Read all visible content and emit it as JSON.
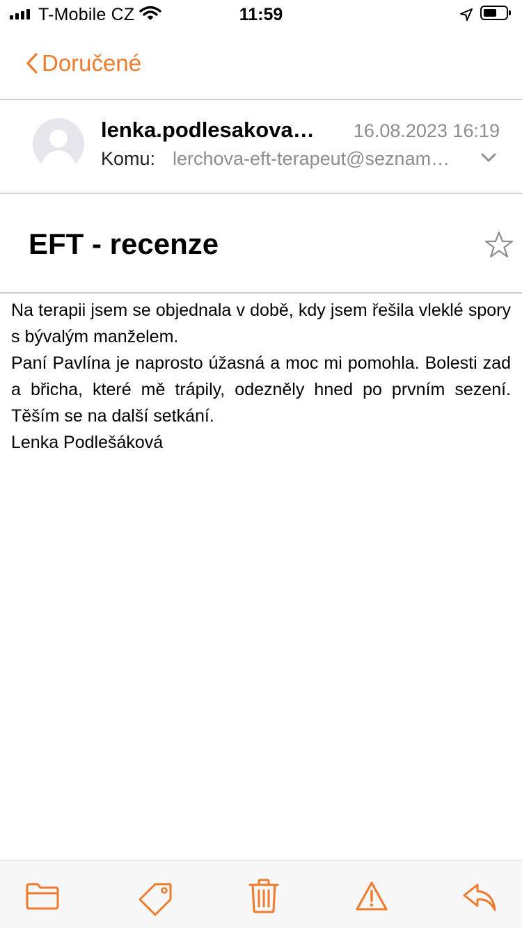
{
  "status_bar": {
    "carrier": "T-Mobile CZ",
    "time": "11:59"
  },
  "nav": {
    "back_label": "Doručené"
  },
  "message": {
    "sender": "lenka.podlesakova@seznam.cz",
    "date": "16.08.2023 16:19",
    "to_label": "Komu:",
    "to_value": "lerchova-eft-terapeut@seznam.cz",
    "subject": "EFT - recenze",
    "body": {
      "p1": "Na terapii jsem se objednala v době, kdy jsem řešila vlek­lé spory s bývalým manželem.",
      "p2": "Paní Pavlína je naprosto úžasná a moc mi pomohla. Bo­lesti zad a břicha, které mě trápily, odezněly hned po prv­ním sezení. Těším se na další setkání.",
      "signature": "Lenka Podlešáková"
    }
  },
  "icons": {
    "accent_color": "#ef7a2c",
    "toolbar": [
      "folder-icon",
      "tag-icon",
      "trash-icon",
      "warning-icon",
      "reply-icon"
    ]
  }
}
